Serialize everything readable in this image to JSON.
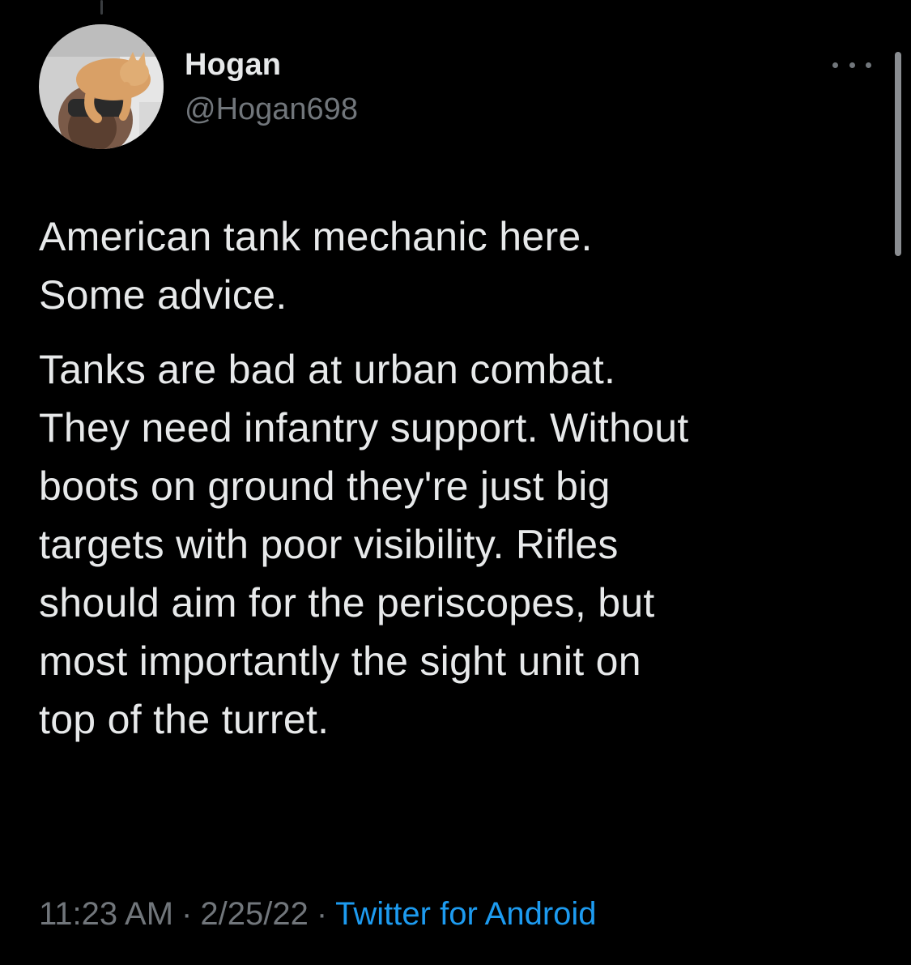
{
  "user": {
    "display_name": "Hogan",
    "handle": "@Hogan698",
    "avatar_icon": "profile-photo-cat-on-head"
  },
  "menu": {
    "more_icon": "more-horizontal-icon"
  },
  "tweet": {
    "paragraphs": [
      "American tank mechanic here.\nSome advice.",
      "Tanks are bad at urban combat.\nThey need infantry support. Without\nboots on ground they're just big\ntargets with poor visibility. Rifles\nshould aim for the periscopes, but\nmost importantly the sight unit on\ntop of the turret."
    ]
  },
  "meta": {
    "time": "11:23 AM",
    "separator": "·",
    "date": "2/25/22",
    "source": "Twitter for Android"
  },
  "colors": {
    "background": "#000000",
    "text": "#e7e9ea",
    "muted": "#71767b",
    "accent": "#1d9bf0"
  }
}
